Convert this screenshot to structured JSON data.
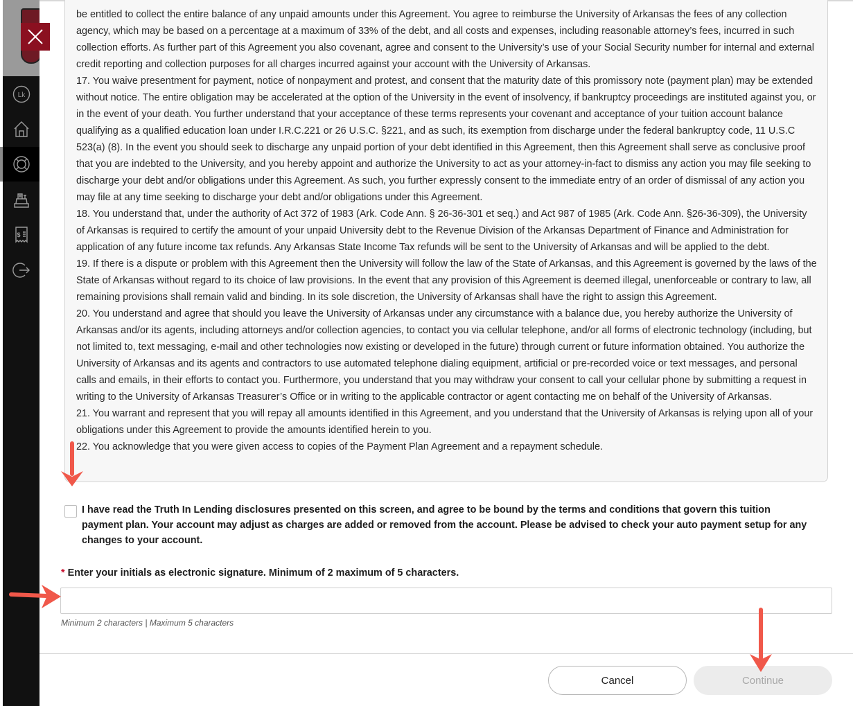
{
  "sidebar": {
    "logo_alt": "University crest",
    "items": [
      {
        "name": "account-initials",
        "label": "Lk",
        "icon": "initials-icon"
      },
      {
        "name": "home",
        "icon": "home-icon"
      },
      {
        "name": "help",
        "icon": "lifebuoy-icon",
        "active": true
      },
      {
        "name": "payments",
        "icon": "cash-register-icon"
      },
      {
        "name": "statements",
        "icon": "receipt-icon"
      },
      {
        "name": "logout",
        "icon": "logout-icon"
      }
    ]
  },
  "modal": {
    "close_label": "Close",
    "agreement_paragraphs": [
      "be entitled to collect the entire balance of any unpaid amounts under this Agreement. You agree to reimburse the University of Arkansas the fees of any collection agency, which may be based on a percentage at a maximum of 33% of the debt, and all costs and expenses, including reasonable attorney’s fees, incurred in such collection efforts. As further part of this Agreement you also covenant, agree and consent to the University’s use of your Social Security number for internal and external credit reporting and collection purposes for all charges incurred against your account with the University of Arkansas.",
      "17. You waive presentment for payment, notice of nonpayment and protest, and consent that the maturity date of this promissory note (payment plan) may be extended without notice. The entire obligation may be accelerated at the option of the University in the event of insolvency, if bankruptcy proceedings are instituted against you, or in the event of your death. You further understand that your acceptance of these terms represents your covenant and acceptance of your tuition account balance qualifying as a qualified education loan under I.R.C.221 or 26 U.S.C. §221, and as such, its exemption from discharge under the federal bankruptcy code, 11 U.S.C 523(a) (8). In the event you should seek to discharge any unpaid portion of your debt identified in this Agreement, then this Agreement shall serve as conclusive proof that you are indebted to the University, and you hereby appoint and authorize the University to act as your attorney-in-fact to dismiss any action you may file seeking to discharge your debt and/or obligations under this Agreement. As such, you further expressly consent to the immediate entry of an order of dismissal of any action you may file at any time seeking to discharge your debt and/or obligations under this Agreement.",
      "18. You understand that, under the authority of Act 372 of 1983 (Ark. Code Ann. § 26-36-301 et seq.) and Act 987 of 1985 (Ark. Code Ann. §26-36-309), the University of Arkansas is required to certify the amount of your unpaid University debt to the Revenue Division of the Arkansas Department of Finance and Administration for application of any future income tax refunds. Any Arkansas State Income Tax refunds will be sent to the University of Arkansas and will be applied to the debt.",
      "19. If there is a dispute or problem with this Agreement then the University will follow the law of the State of Arkansas, and this Agreement is governed by the laws of the State of Arkansas without regard to its choice of law provisions. In the event that any provision of this Agreement is deemed illegal, unenforceable or contrary to law, all remaining provisions shall remain valid and binding. In its sole discretion, the University of Arkansas shall have the right to assign this Agreement.",
      "20. You understand and agree that should you leave the University of Arkansas under any circumstance with a balance due, you hereby authorize the University of Arkansas and/or its agents, including attorneys and/or collection agencies, to contact you via cellular telephone, and/or all forms of electronic technology (including, but not limited to, text messaging, e-mail and other technologies now existing or developed in the future) through current or future information obtained. You authorize the University of Arkansas and its agents and contractors to use automated telephone dialing equipment, artificial or pre-recorded voice or text messages, and personal calls and emails, in their efforts to contact you. Furthermore, you understand that you may withdraw your consent to call your cellular phone by submitting a request in writing to the University of Arkansas Treasurer’s Office or in writing to the applicable contractor or agent contacting me on behalf of the University of Arkansas.",
      "21. You warrant and represent that you will repay all amounts identified in this Agreement, and you understand that the University of Arkansas is relying upon all of your obligations under this Agreement to provide the amounts identified herein to you.",
      "22. You acknowledge that you were given access to copies of the Payment Plan Agreement and a repayment schedule."
    ],
    "consent": {
      "checked": false,
      "text": "I have read the Truth In Lending disclosures presented on this screen, and agree to be bound by the terms and conditions that govern this tuition payment plan. Your account may adjust as charges are added or removed from the account. Please be advised to check your auto payment setup for any changes to your account."
    },
    "signature": {
      "required_marker": "*",
      "label": "Enter your initials as electronic signature. Minimum of 2 maximum of 5 characters.",
      "value": "",
      "help": "Minimum 2 characters | Maximum 5 characters"
    },
    "buttons": {
      "cancel": "Cancel",
      "continue": "Continue"
    }
  },
  "colors": {
    "brand": "#8b1020",
    "required": "#c8102e",
    "annotation_arrow": "#f0584a",
    "disabled_button": "#ececec"
  }
}
